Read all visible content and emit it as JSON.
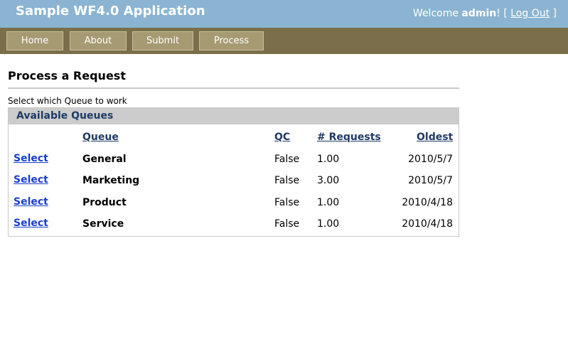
{
  "header": {
    "app_title": "Sample WF4.0 Application",
    "welcome_prefix": "Welcome ",
    "username": "admin",
    "bang_bracket": "! [ ",
    "logout_label": "Log Out",
    "close_bracket": " ]"
  },
  "menu": {
    "items": [
      {
        "label": "Home"
      },
      {
        "label": "About"
      },
      {
        "label": "Submit"
      },
      {
        "label": "Process"
      }
    ]
  },
  "page": {
    "title": "Process a Request",
    "instruction": "Select which Queue to work"
  },
  "queues": {
    "panel_title": "Available Queues",
    "columns": {
      "queue": "Queue",
      "qc": "QC",
      "requests": "# Requests",
      "oldest": "Oldest"
    },
    "select_label": "Select",
    "rows": [
      {
        "queue": "General",
        "qc": "False",
        "requests": "1.00",
        "oldest": "2010/5/7"
      },
      {
        "queue": "Marketing",
        "qc": "False",
        "requests": "3.00",
        "oldest": "2010/5/7"
      },
      {
        "queue": "Product",
        "qc": "False",
        "requests": "1.00",
        "oldest": "2010/4/18"
      },
      {
        "queue": "Service",
        "qc": "False",
        "requests": "1.00",
        "oldest": "2010/4/18"
      }
    ]
  },
  "colors": {
    "header_bg": "#8ab4d1",
    "menu_bg": "#7a6f4a",
    "menu_button_bg": "#a69a72",
    "link_blue": "#1a3fcc",
    "heading_navy": "#1f3a66"
  }
}
